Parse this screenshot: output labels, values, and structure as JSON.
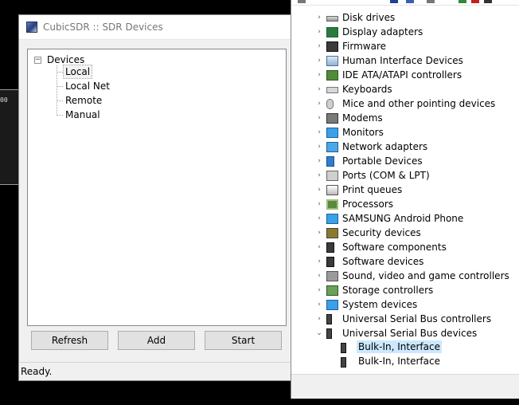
{
  "background_fragment": {
    "text": "00"
  },
  "sdr_dialog": {
    "title": "CubicSDR :: SDR Devices",
    "tree": {
      "root_expander": "−",
      "root_label": "Devices",
      "children": [
        "Local",
        "Local Net",
        "Remote",
        "Manual"
      ],
      "selected": "Local"
    },
    "buttons": {
      "refresh": "Refresh",
      "add": "Add",
      "start": "Start"
    },
    "status": "Ready."
  },
  "device_manager": {
    "categories": [
      {
        "label": "Disk drives",
        "icon": "disk-drive-icon",
        "expanded": false
      },
      {
        "label": "Display adapters",
        "icon": "display-adapter-icon",
        "expanded": false
      },
      {
        "label": "Firmware",
        "icon": "firmware-icon",
        "expanded": false
      },
      {
        "label": "Human Interface Devices",
        "icon": "hid-icon",
        "expanded": false
      },
      {
        "label": "IDE ATA/ATAPI controllers",
        "icon": "ide-controller-icon",
        "expanded": false
      },
      {
        "label": "Keyboards",
        "icon": "keyboard-icon",
        "expanded": false
      },
      {
        "label": "Mice and other pointing devices",
        "icon": "mouse-icon",
        "expanded": false
      },
      {
        "label": "Modems",
        "icon": "modem-icon",
        "expanded": false
      },
      {
        "label": "Monitors",
        "icon": "monitor-icon",
        "expanded": false
      },
      {
        "label": "Network adapters",
        "icon": "network-adapter-icon",
        "expanded": false
      },
      {
        "label": "Portable Devices",
        "icon": "portable-device-icon",
        "expanded": false
      },
      {
        "label": "Ports (COM & LPT)",
        "icon": "port-icon",
        "expanded": false
      },
      {
        "label": "Print queues",
        "icon": "printer-icon",
        "expanded": false
      },
      {
        "label": "Processors",
        "icon": "processor-icon",
        "expanded": false
      },
      {
        "label": "SAMSUNG Android Phone",
        "icon": "android-phone-icon",
        "expanded": false
      },
      {
        "label": "Security devices",
        "icon": "security-device-icon",
        "expanded": false
      },
      {
        "label": "Software components",
        "icon": "software-component-icon",
        "expanded": false
      },
      {
        "label": "Software devices",
        "icon": "software-device-icon",
        "expanded": false
      },
      {
        "label": "Sound, video and game controllers",
        "icon": "speaker-icon",
        "expanded": false
      },
      {
        "label": "Storage controllers",
        "icon": "storage-controller-icon",
        "expanded": false
      },
      {
        "label": "System devices",
        "icon": "system-device-icon",
        "expanded": false
      },
      {
        "label": "Universal Serial Bus controllers",
        "icon": "usb-controller-icon",
        "expanded": false
      },
      {
        "label": "Universal Serial Bus devices",
        "icon": "usb-device-icon",
        "expanded": true
      }
    ],
    "usb_devices_children": [
      {
        "label": "Bulk-In, Interface",
        "icon": "usb-plug-icon",
        "selected": true
      },
      {
        "label": "Bulk-In, Interface",
        "icon": "usb-plug-icon",
        "selected": false
      }
    ],
    "chevrons": {
      "collapsed": "›",
      "expanded": "⌄"
    }
  },
  "colors": {
    "selection": "#cce8ff",
    "tree_line": "#a0a0a0",
    "button_face": "#e1e1e1"
  }
}
